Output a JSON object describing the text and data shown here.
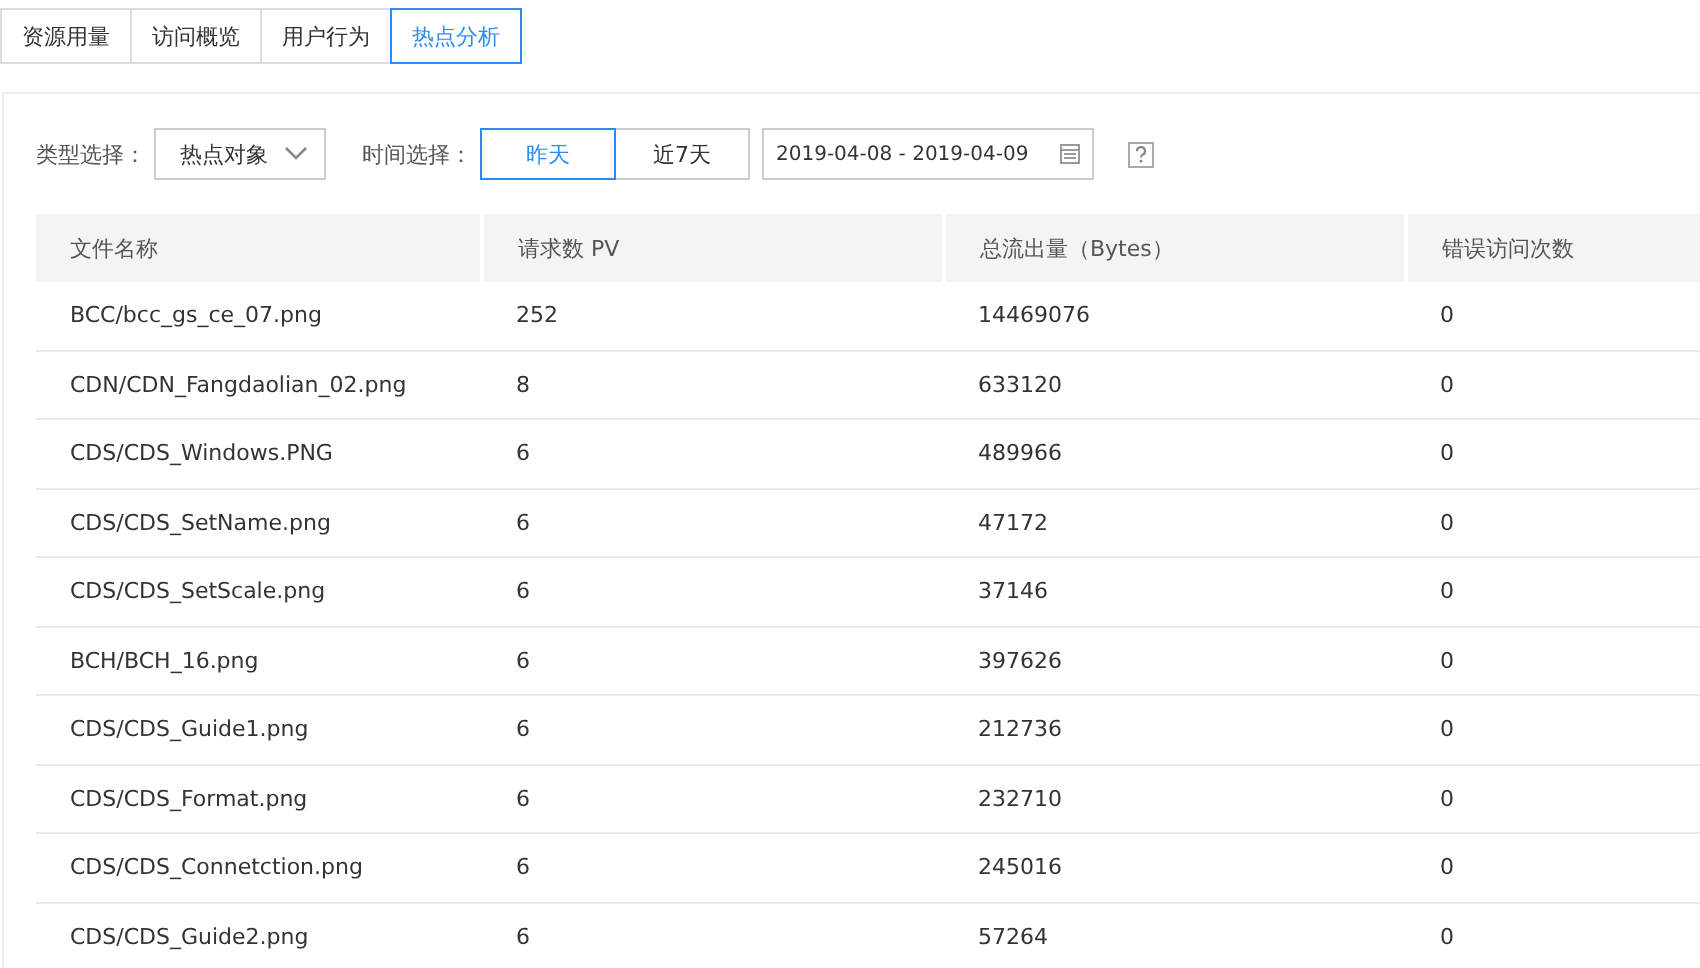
{
  "tabs": [
    {
      "label": "资源用量",
      "selected": false
    },
    {
      "label": "访问概览",
      "selected": false
    },
    {
      "label": "用户行为",
      "selected": false
    },
    {
      "label": "热点分析",
      "selected": true
    }
  ],
  "filters": {
    "type_label": "类型选择：",
    "type_value": "热点对象",
    "time_label": "时间选择：",
    "time_options": [
      {
        "label": "昨天",
        "selected": true
      },
      {
        "label": "近7天",
        "selected": false
      }
    ],
    "date_range": "2019-04-08 - 2019-04-09"
  },
  "table": {
    "columns": [
      "文件名称",
      "请求数 PV",
      "总流出量（Bytes）",
      "错误访问次数"
    ],
    "rows": [
      [
        "BCC/bcc_gs_ce_07.png",
        "252",
        "14469076",
        "0"
      ],
      [
        "CDN/CDN_Fangdaolian_02.png",
        "8",
        "633120",
        "0"
      ],
      [
        "CDS/CDS_Windows.PNG",
        "6",
        "489966",
        "0"
      ],
      [
        "CDS/CDS_SetName.png",
        "6",
        "47172",
        "0"
      ],
      [
        "CDS/CDS_SetScale.png",
        "6",
        "37146",
        "0"
      ],
      [
        "BCH/BCH_16.png",
        "6",
        "397626",
        "0"
      ],
      [
        "CDS/CDS_Guide1.png",
        "6",
        "212736",
        "0"
      ],
      [
        "CDS/CDS_Format.png",
        "6",
        "232710",
        "0"
      ],
      [
        "CDS/CDS_Connetction.png",
        "6",
        "245016",
        "0"
      ],
      [
        "CDS/CDS_Guide2.png",
        "6",
        "57264",
        "0"
      ]
    ]
  }
}
